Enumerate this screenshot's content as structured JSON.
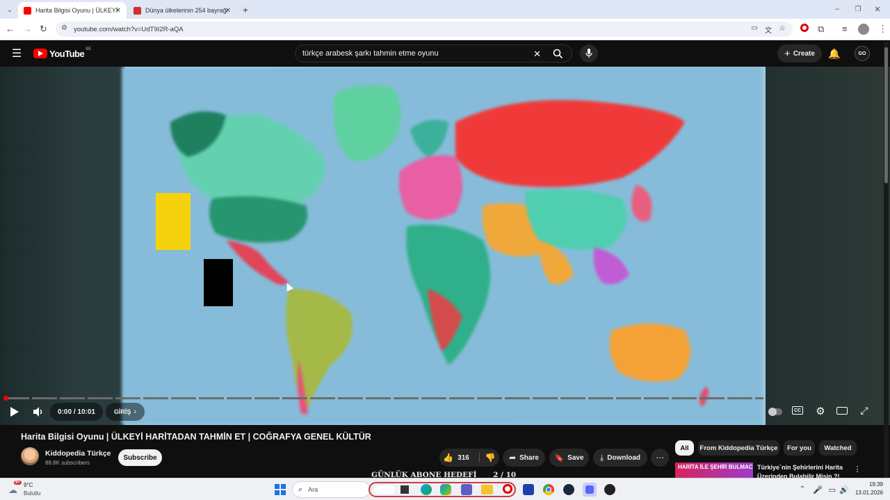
{
  "browser": {
    "tabs": [
      {
        "label": "Harita Bilgisi Oyunu | ÜLKEYİ H…",
        "favicon_color": "#ff0000"
      },
      {
        "label": "Dünya ülkelerinin 254 bayrağı…",
        "favicon_color": "#d32f2f"
      }
    ],
    "url": "youtube.com/watch?v=UdT9I2R-aQA"
  },
  "youtube": {
    "logo_text": "YouTube",
    "region": "BE",
    "search_query": "türkçe arabesk şarkı tahmin etme oyunu",
    "create_label": "Create"
  },
  "player": {
    "time": "0:00 / 10:01",
    "chapter": "GİRİŞ",
    "progress_fraction": 0.0
  },
  "video": {
    "title": "Harita Bilgisi Oyunu | ÜLKEYİ HARİTADAN TAHMİN ET | COĞRAFYA GENEL KÜLTÜR",
    "channel": "Kiddopedia Türkçe",
    "subscribers": "88.8K subscribers",
    "subscribe_label": "Subscribe",
    "likes": "316",
    "share_label": "Share",
    "save_label": "Save",
    "download_label": "Download",
    "banner_text": "GÜNLÜK ABONE HEDEFİ",
    "banner_count": "2 / 10"
  },
  "sidebar": {
    "chips": [
      "All",
      "From Kiddopedia Türkçe",
      "For you",
      "Watched"
    ],
    "rec_thumb_text": "HARİTA İLE ŞEHİR BULMACA",
    "rec_title": "Türkiye`nin Şehirlerini Harita Üzerinden Bulabilir Misin ?!"
  },
  "taskbar": {
    "weather_temp": "9°C",
    "weather_desc": "Bulutlu",
    "weather_badge": "9+",
    "search_placeholder": "Ara",
    "time": "19:39",
    "date": "13.01.2026"
  }
}
